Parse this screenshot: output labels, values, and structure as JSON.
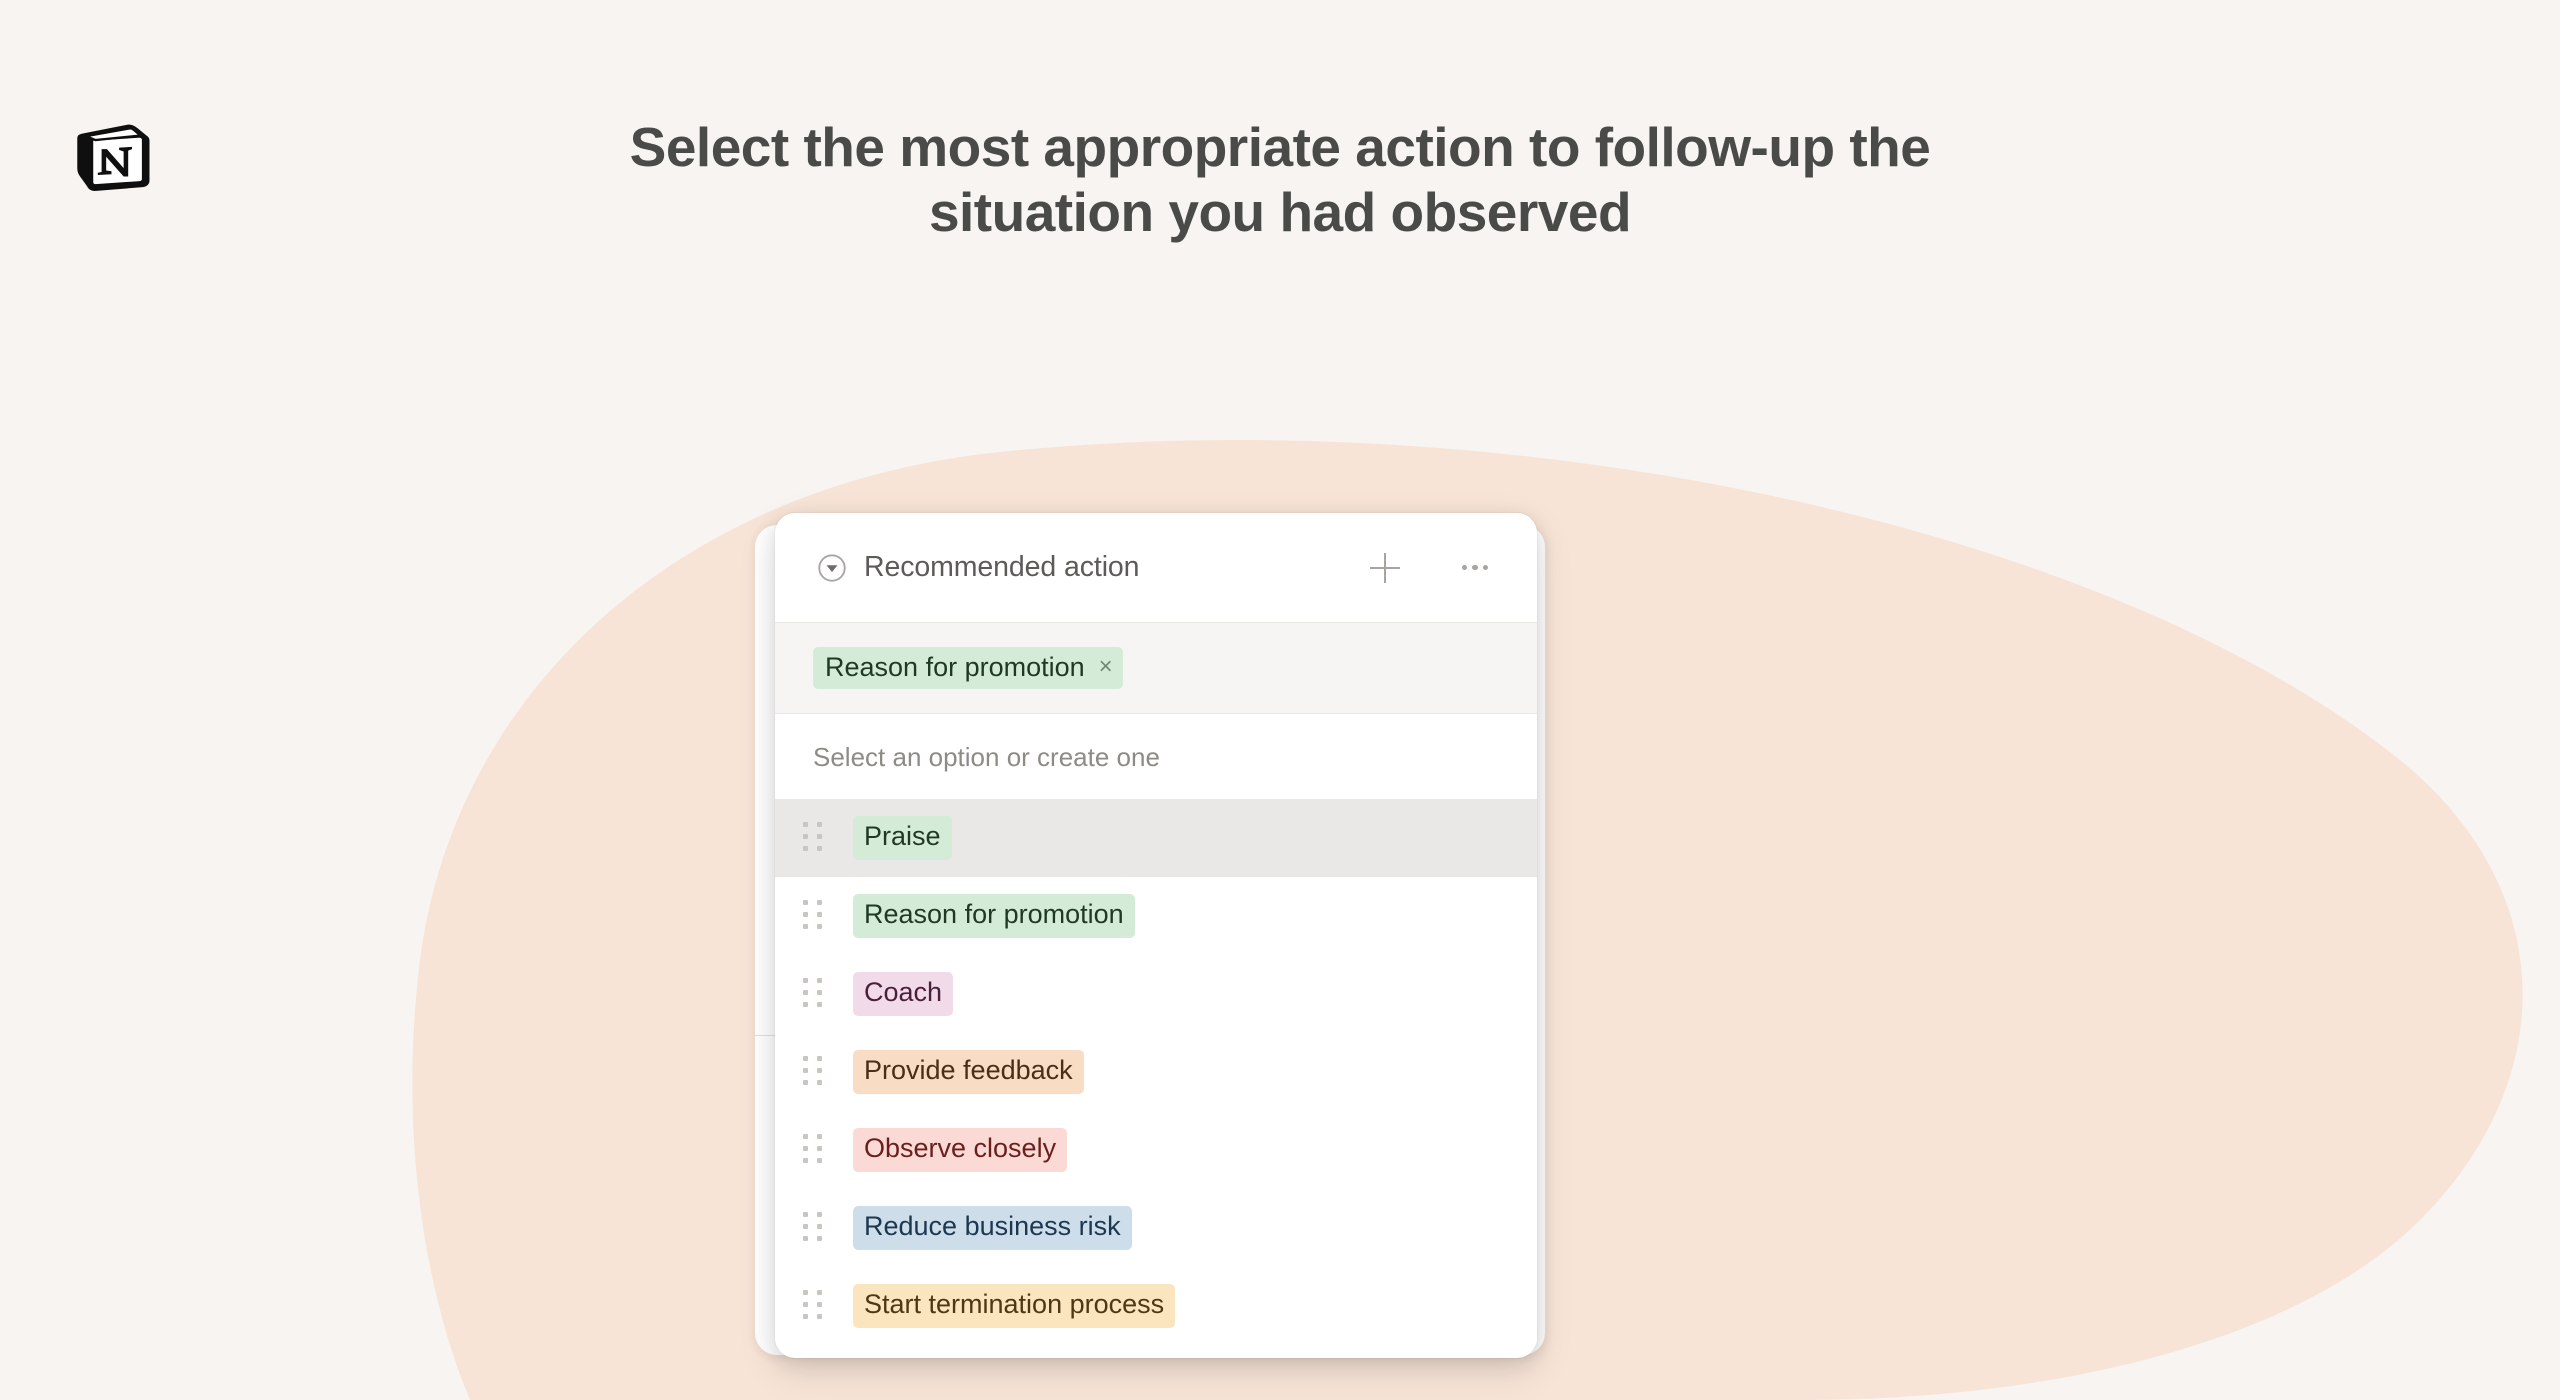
{
  "page": {
    "background_color": "#f7f4f1",
    "blob_color": "#f7e4d7"
  },
  "brand": {
    "logo_icon": "notion-logo-icon",
    "name": "Notion"
  },
  "headline": {
    "line1": "Select the most appropriate action to follow-up the",
    "line2": "situation you had observed",
    "color": "#4a4a48"
  },
  "popup": {
    "header": {
      "expand_icon": "chevron-down-circle-icon",
      "title": "Recommended action",
      "add_icon": "plus-icon",
      "more_icon": "more-horizontal-icon"
    },
    "selected": {
      "label": "Reason for promotion",
      "remove_icon": "×",
      "bg": "#d4ebd8",
      "fg": "#1e3a23"
    },
    "hint": "Select an option or create one",
    "options": [
      {
        "label": "Praise",
        "bg": "#d4ebd8",
        "fg": "#1e3a23",
        "handle_icon": "drag-handle-icon",
        "active": true
      },
      {
        "label": "Reason for promotion",
        "bg": "#d4ebd8",
        "fg": "#1e3a23",
        "handle_icon": "drag-handle-icon",
        "active": false
      },
      {
        "label": "Coach",
        "bg": "#f2dbe8",
        "fg": "#4a1f39",
        "handle_icon": "drag-handle-icon",
        "active": false
      },
      {
        "label": "Provide feedback",
        "bg": "#f8ddc4",
        "fg": "#4b2e13",
        "handle_icon": "drag-handle-icon",
        "active": false
      },
      {
        "label": "Observe closely",
        "bg": "#fbd9d5",
        "fg": "#6b1f1c",
        "handle_icon": "drag-handle-icon",
        "active": false
      },
      {
        "label": "Reduce business risk",
        "bg": "#cddeea",
        "fg": "#1d3750",
        "handle_icon": "drag-handle-icon",
        "active": false
      },
      {
        "label": "Start termination process",
        "bg": "#fbe5bf",
        "fg": "#4d3714",
        "handle_icon": "drag-handle-icon",
        "active": false
      }
    ]
  }
}
